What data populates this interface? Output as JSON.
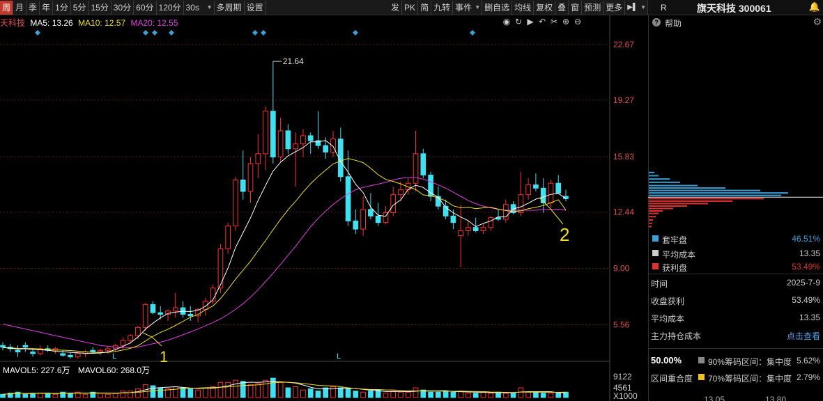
{
  "toolbar": {
    "left": [
      "周",
      "月",
      "季",
      "年",
      "1分",
      "5分",
      "15分",
      "30分",
      "60分",
      "120分"
    ],
    "dd_30s": "30s",
    "multi_period": "多周期",
    "settings": "设置",
    "right": [
      "发",
      "PK",
      "简",
      "九转"
    ],
    "event": "事件",
    "right2": [
      "删自选",
      "均线",
      "复权",
      "叠",
      "窗",
      "预测",
      "更多"
    ],
    "nav_icon": "▶▌"
  },
  "stock": {
    "name_partial": "天科技",
    "ma5": "MA5: 13.26",
    "ma10": "MA10: 12.57",
    "ma20": "MA20: 12.55",
    "ma5_color": "#ffffff",
    "ma10_color": "#f0e020",
    "ma20_color": "#e040e0"
  },
  "right_panel": {
    "r_label": "R",
    "title": "旗天科技 300061",
    "help": "帮助",
    "legend": [
      {
        "label": "套牢盘",
        "value": "46.51%",
        "color": "#3aa0d8"
      },
      {
        "label": "平均成本",
        "value": "13.35",
        "color": "#cccccc"
      },
      {
        "label": "获利盘",
        "value": "53.49%",
        "color": "#e03030"
      }
    ],
    "info": [
      {
        "label": "时间",
        "value": "2025-7-9"
      },
      {
        "label": "收盘获利",
        "value": "53.49%"
      },
      {
        "label": "平均成本",
        "value": "13.35"
      },
      {
        "label": "主力持仓成本",
        "value": "点击查看"
      }
    ],
    "overlap_pct": "50.00%",
    "overlap_label": "区间重合度",
    "chip90": "90%筹码区间：集中度",
    "chip90_val": "5.62%",
    "chip70": "70%筹码区间：集中度",
    "chip70_val": "2.79%",
    "chip_axis": [
      "13.05",
      "13.80"
    ]
  },
  "volume": {
    "mavol5": "MAVOL5: 227.6万",
    "mavol60": "MAVOL60: 268.0万",
    "axis": [
      "9122",
      "4561",
      "X1000"
    ]
  },
  "chart_data": {
    "type": "candlestick",
    "y_ticks": [
      "22.67",
      "19.27",
      "15.83",
      "12.44",
      "9.00",
      "5.56"
    ],
    "ylim": [
      3.5,
      23.6
    ],
    "annotations": {
      "high_label": "21.64",
      "marker1": "1",
      "marker2": "2",
      "L_marks": [
        "L",
        "L"
      ]
    },
    "candles": [
      [
        4.3,
        4.5,
        4.0,
        4.2
      ],
      [
        4.2,
        4.4,
        3.9,
        4.1
      ],
      [
        4.0,
        4.3,
        3.6,
        3.9
      ],
      [
        4.3,
        4.5,
        3.9,
        4.2
      ],
      [
        3.9,
        4.1,
        3.6,
        3.8
      ],
      [
        3.8,
        4.3,
        3.7,
        4.1
      ],
      [
        4.1,
        4.3,
        3.9,
        4.0
      ],
      [
        4.0,
        4.2,
        3.8,
        4.1
      ],
      [
        3.8,
        4.0,
        3.6,
        3.7
      ],
      [
        3.7,
        3.9,
        3.5,
        3.6
      ],
      [
        3.6,
        3.9,
        3.5,
        3.8
      ],
      [
        3.8,
        4.0,
        3.6,
        3.9
      ],
      [
        4.0,
        4.2,
        3.8,
        3.9
      ],
      [
        3.9,
        4.1,
        3.7,
        4.0
      ],
      [
        4.0,
        4.2,
        3.8,
        4.1
      ],
      [
        4.1,
        4.4,
        3.9,
        4.3
      ],
      [
        4.3,
        4.8,
        4.1,
        4.6
      ],
      [
        4.6,
        5.0,
        4.4,
        4.9
      ],
      [
        4.9,
        5.5,
        4.7,
        5.4
      ],
      [
        5.4,
        6.9,
        5.2,
        6.8
      ],
      [
        6.8,
        7.0,
        6.2,
        6.3
      ],
      [
        6.3,
        6.7,
        5.9,
        6.2
      ],
      [
        6.2,
        6.5,
        5.8,
        6.4
      ],
      [
        6.4,
        7.5,
        6.0,
        6.6
      ],
      [
        6.6,
        7.0,
        6.0,
        6.2
      ],
      [
        6.2,
        6.7,
        5.8,
        6.1
      ],
      [
        6.1,
        6.6,
        5.7,
        6.5
      ],
      [
        6.5,
        7.2,
        6.1,
        7.0
      ],
      [
        7.0,
        8.0,
        6.8,
        7.8
      ],
      [
        7.8,
        10.5,
        7.5,
        10.2
      ],
      [
        10.2,
        11.8,
        9.9,
        11.6
      ],
      [
        11.6,
        14.6,
        11.3,
        14.4
      ],
      [
        14.4,
        16.2,
        13.2,
        13.7
      ],
      [
        13.7,
        15.8,
        13.0,
        15.4
      ],
      [
        15.4,
        17.2,
        14.5,
        16.0
      ],
      [
        16.0,
        18.9,
        15.0,
        18.6
      ],
      [
        18.6,
        21.64,
        15.4,
        15.8
      ],
      [
        15.8,
        18.2,
        15.5,
        17.4
      ],
      [
        17.4,
        17.8,
        16.0,
        16.3
      ],
      [
        16.3,
        17.3,
        14.0,
        16.6
      ],
      [
        16.6,
        17.5,
        15.8,
        17.1
      ],
      [
        17.1,
        17.3,
        16.0,
        16.8
      ],
      [
        16.8,
        18.6,
        16.3,
        16.5
      ],
      [
        16.5,
        17.0,
        15.7,
        16.1
      ],
      [
        16.1,
        17.4,
        15.8,
        16.9
      ],
      [
        16.9,
        17.6,
        14.3,
        14.6
      ],
      [
        14.6,
        16.2,
        11.6,
        11.9
      ],
      [
        11.9,
        12.6,
        11.1,
        11.4
      ],
      [
        11.4,
        13.4,
        11.0,
        12.6
      ],
      [
        12.6,
        13.6,
        12.0,
        12.2
      ],
      [
        12.2,
        13.0,
        11.6,
        11.8
      ],
      [
        11.8,
        12.8,
        11.7,
        12.4
      ],
      [
        12.4,
        14.0,
        12.2,
        13.5
      ],
      [
        13.5,
        14.3,
        13.1,
        13.8
      ],
      [
        13.8,
        14.5,
        13.5,
        14.2
      ],
      [
        14.2,
        17.4,
        13.7,
        16.0
      ],
      [
        16.0,
        16.3,
        14.5,
        14.7
      ],
      [
        14.7,
        14.9,
        13.1,
        13.4
      ],
      [
        13.4,
        14.0,
        12.6,
        12.8
      ],
      [
        12.8,
        13.2,
        12.0,
        12.2
      ],
      [
        12.2,
        12.6,
        11.4,
        11.8
      ],
      [
        11.0,
        12.9,
        9.1,
        11.3
      ],
      [
        11.3,
        11.9,
        11.0,
        11.5
      ],
      [
        11.5,
        12.1,
        11.2,
        11.3
      ],
      [
        11.3,
        11.7,
        11.1,
        11.5
      ],
      [
        11.5,
        12.2,
        11.3,
        12.1
      ],
      [
        12.1,
        12.6,
        11.9,
        12.0
      ],
      [
        12.0,
        13.2,
        11.8,
        12.9
      ],
      [
        12.9,
        13.1,
        12.3,
        12.4
      ],
      [
        12.4,
        14.9,
        12.2,
        13.5
      ],
      [
        13.5,
        14.5,
        13.2,
        14.1
      ],
      [
        14.1,
        14.8,
        13.7,
        13.9
      ],
      [
        13.9,
        14.5,
        12.4,
        13.0
      ],
      [
        13.0,
        14.4,
        12.7,
        14.2
      ],
      [
        14.2,
        14.7,
        13.7,
        13.6
      ],
      [
        13.4,
        13.8,
        13.1,
        13.26
      ]
    ],
    "volumes": [
      3,
      4,
      5,
      3,
      4,
      4,
      4,
      3,
      5,
      4,
      5,
      3,
      5,
      4,
      3,
      4,
      6,
      6,
      8,
      12,
      11,
      9,
      8,
      10,
      9,
      8,
      7,
      9,
      10,
      14,
      14,
      16,
      15,
      12,
      13,
      16,
      18,
      14,
      9,
      10,
      7,
      8,
      6,
      9,
      10,
      9,
      8,
      6,
      5,
      6,
      7,
      4,
      6,
      5,
      5,
      9,
      7,
      5,
      5,
      6,
      5,
      6,
      4,
      4,
      5,
      4,
      5,
      4,
      4,
      9,
      5,
      5,
      4,
      4,
      4,
      5
    ],
    "ma5": [
      4.17,
      4.13,
      4.08,
      4.1,
      4.05,
      4.03,
      4.01,
      3.94,
      3.92,
      3.88,
      3.85,
      3.82,
      3.82,
      3.84,
      3.9,
      4.04,
      4.24,
      4.46,
      4.81,
      5.29,
      5.66,
      5.98,
      6.26,
      6.33,
      6.39,
      6.37,
      6.44,
      6.69,
      7.09,
      8.0,
      9.02,
      10.28,
      11.17,
      12.09,
      13.14,
      14.07,
      14.94,
      15.48,
      15.87,
      16.13,
      16.37,
      16.73,
      16.73,
      16.81,
      16.45,
      15.52,
      14.88,
      14.14,
      13.63,
      12.74,
      12.25,
      12.18,
      12.86,
      13.18,
      13.82,
      14.08,
      13.94,
      13.62,
      13.34,
      12.73,
      12.4,
      12.14,
      11.92,
      11.55,
      11.75,
      11.9,
      12.15,
      12.14,
      12.63,
      12.76,
      12.98,
      13.23,
      13.36,
      13.52,
      13.58,
      13.26
    ],
    "ma10": [
      4.17,
      4.15,
      4.12,
      4.11,
      4.11,
      4.08,
      4.07,
      4.02,
      4.01,
      3.99,
      3.95,
      3.91,
      3.88,
      3.87,
      3.88,
      3.93,
      4.02,
      4.12,
      4.28,
      4.57,
      4.86,
      5.09,
      5.29,
      5.52,
      5.77,
      6.02,
      6.19,
      6.47,
      6.71,
      7.16,
      7.73,
      8.34,
      8.89,
      9.44,
      10.08,
      10.7,
      11.36,
      11.99,
      12.58,
      13.1,
      13.65,
      14.17,
      14.61,
      15.0,
      15.38,
      15.56,
      15.71,
      15.6,
      15.46,
      15.12,
      14.72,
      14.44,
      14.31,
      14.16,
      13.97,
      13.82,
      13.49,
      13.43,
      13.31,
      13.13,
      12.82,
      12.7,
      12.74,
      12.65,
      12.7,
      12.74,
      12.62,
      12.53,
      12.48,
      12.51,
      12.65,
      12.73,
      12.84,
      13.01,
      13.19,
      12.57
    ],
    "ma20": [
      5.6,
      5.5,
      5.4,
      5.3,
      5.2,
      5.1,
      5.0,
      4.9,
      4.8,
      4.7,
      4.6,
      4.5,
      4.4,
      4.3,
      4.25,
      4.2,
      4.18,
      4.16,
      4.2,
      4.3,
      4.4,
      4.5,
      4.62,
      4.78,
      4.95,
      5.12,
      5.3,
      5.5,
      5.7,
      5.92,
      6.2,
      6.5,
      6.85,
      7.25,
      7.7,
      8.2,
      8.7,
      9.25,
      9.8,
      10.35,
      10.95,
      11.55,
      12.05,
      12.5,
      12.9,
      13.25,
      13.55,
      13.8,
      13.95,
      14.05,
      14.15,
      14.25,
      14.4,
      14.5,
      14.55,
      14.55,
      14.45,
      14.3,
      14.1,
      13.9,
      13.65,
      13.4,
      13.15,
      12.95,
      12.8,
      12.7,
      12.6,
      12.55,
      12.55,
      12.55,
      12.55,
      12.55,
      12.6,
      12.6,
      12.62,
      12.55
    ],
    "chip_bars": [
      {
        "y": 14.9,
        "w": 8,
        "c": "b"
      },
      {
        "y": 14.7,
        "w": 14,
        "c": "b"
      },
      {
        "y": 14.5,
        "w": 30,
        "c": "b"
      },
      {
        "y": 14.3,
        "w": 45,
        "c": "b"
      },
      {
        "y": 14.1,
        "w": 70,
        "c": "b"
      },
      {
        "y": 13.95,
        "w": 110,
        "c": "b"
      },
      {
        "y": 13.8,
        "w": 160,
        "c": "b"
      },
      {
        "y": 13.65,
        "w": 200,
        "c": "b"
      },
      {
        "y": 13.5,
        "w": 190,
        "c": "b"
      },
      {
        "y": 13.3,
        "w": 165,
        "c": "r"
      },
      {
        "y": 13.15,
        "w": 120,
        "c": "r"
      },
      {
        "y": 13.0,
        "w": 85,
        "c": "r"
      },
      {
        "y": 12.85,
        "w": 55,
        "c": "r"
      },
      {
        "y": 12.7,
        "w": 35,
        "c": "r"
      },
      {
        "y": 12.55,
        "w": 20,
        "c": "r"
      },
      {
        "y": 12.4,
        "w": 14,
        "c": "r"
      },
      {
        "y": 12.2,
        "w": 10,
        "c": "r"
      },
      {
        "y": 12.0,
        "w": 6,
        "c": "r"
      },
      {
        "y": 11.8,
        "w": 5,
        "c": "r"
      },
      {
        "y": 11.6,
        "w": 4,
        "c": "r"
      }
    ]
  }
}
